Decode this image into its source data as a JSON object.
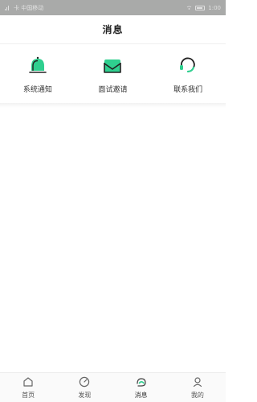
{
  "status_bar": {
    "left": "卡 中国移动",
    "right_time": "1:00"
  },
  "header": {
    "title": "消息"
  },
  "quick_actions": [
    {
      "label": "系统通知",
      "icon": "bell-icon"
    },
    {
      "label": "面试邀请",
      "icon": "envelope-icon"
    },
    {
      "label": "联系我们",
      "icon": "headset-icon"
    }
  ],
  "tabs": [
    {
      "label": "首页",
      "icon": "home-icon"
    },
    {
      "label": "发现",
      "icon": "compass-icon"
    },
    {
      "label": "消息",
      "icon": "message-icon",
      "active": true
    },
    {
      "label": "我的",
      "icon": "user-icon"
    }
  ],
  "colors": {
    "accent": "#2fcf8f",
    "status_bar_bg": "#a9aaa9",
    "text": "#222222"
  }
}
